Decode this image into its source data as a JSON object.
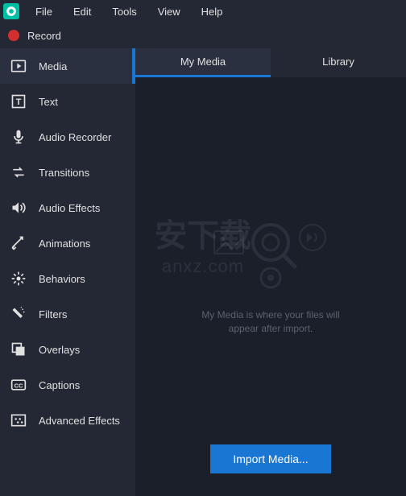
{
  "menubar": {
    "items": [
      "File",
      "Edit",
      "Tools",
      "View",
      "Help"
    ]
  },
  "record": {
    "label": "Record"
  },
  "sidebar": {
    "items": [
      {
        "label": "Media",
        "icon": "media",
        "active": true
      },
      {
        "label": "Text",
        "icon": "text"
      },
      {
        "label": "Audio Recorder",
        "icon": "mic"
      },
      {
        "label": "Transitions",
        "icon": "transitions"
      },
      {
        "label": "Audio Effects",
        "icon": "audio-effects"
      },
      {
        "label": "Animations",
        "icon": "animations"
      },
      {
        "label": "Behaviors",
        "icon": "behaviors"
      },
      {
        "label": "Filters",
        "icon": "filters"
      },
      {
        "label": "Overlays",
        "icon": "overlays"
      },
      {
        "label": "Captions",
        "icon": "captions"
      },
      {
        "label": "Advanced Effects",
        "icon": "advanced"
      }
    ]
  },
  "tabs": {
    "items": [
      {
        "label": "My Media",
        "active": true
      },
      {
        "label": "Library"
      }
    ]
  },
  "content": {
    "placeholder": "My Media is where your files will appear after import.",
    "import_button": "Import Media..."
  },
  "watermark": {
    "cn": "安下载",
    "en": "anxz.com"
  }
}
